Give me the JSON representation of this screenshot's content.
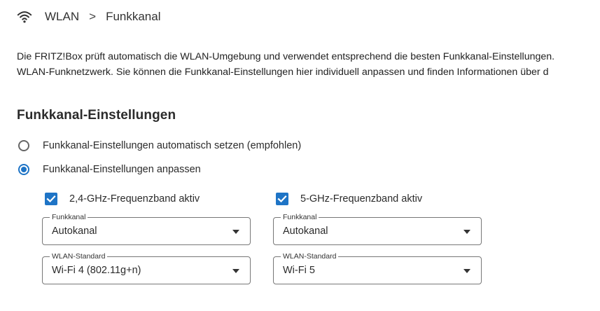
{
  "breadcrumb": {
    "icon": "wifi-icon",
    "parent": "WLAN",
    "separator": ">",
    "current": "Funkkanal"
  },
  "description": {
    "line1": "Die FRITZ!Box prüft automatisch die WLAN-Umgebung und verwendet entsprechend die besten Funkkanal-Einstellungen. ",
    "line2": "WLAN-Funknetzwerk. Sie können die Funkkanal-Einstellungen hier individuell anpassen und finden Informationen über d"
  },
  "section": {
    "title": "Funkkanal-Einstellungen",
    "options": [
      {
        "label": "Funkkanal-Einstellungen automatisch setzen (empfohlen)",
        "selected": false
      },
      {
        "label": "Funkkanal-Einstellungen anpassen",
        "selected": true
      }
    ]
  },
  "bands": [
    {
      "label": "2,4-GHz-Frequenzband aktiv",
      "active": true,
      "channel": {
        "legend": "Funkkanal",
        "value": "Autokanal"
      },
      "standard": {
        "legend": "WLAN-Standard",
        "value": "Wi-Fi 4 (802.11g+n)"
      }
    },
    {
      "label": "5-GHz-Frequenzband aktiv",
      "active": true,
      "channel": {
        "legend": "Funkkanal",
        "value": "Autokanal"
      },
      "standard": {
        "legend": "WLAN-Standard",
        "value": "Wi-Fi 5"
      }
    }
  ],
  "colors": {
    "accent": "#1e74c6",
    "text": "#2b2b2b",
    "border": "#777777"
  }
}
